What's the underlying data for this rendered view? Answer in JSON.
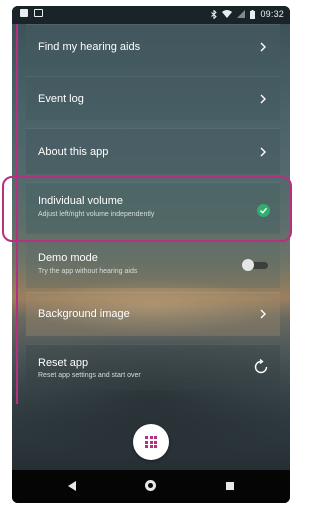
{
  "status_bar": {
    "time": "09:32",
    "icons": [
      "notification-icon",
      "photo-icon",
      "bluetooth-icon",
      "wifi-icon",
      "signal-icon",
      "battery-icon"
    ]
  },
  "menu": {
    "items": [
      {
        "label": "Find my hearing aids",
        "control": "chevron"
      },
      {
        "label": "Event log",
        "control": "chevron"
      },
      {
        "label": "About this app",
        "control": "chevron"
      },
      {
        "label": "Individual volume",
        "sublabel": "Adjust left/right volume independently",
        "control": "check",
        "checked": true
      },
      {
        "label": "Demo mode",
        "sublabel": "Try the app without hearing aids",
        "control": "toggle",
        "on": false
      },
      {
        "label": "Background image",
        "control": "chevron"
      },
      {
        "label": "Reset app",
        "sublabel": "Reset app settings and start over",
        "control": "reset"
      }
    ]
  },
  "fab": {
    "icon": "grid-icon"
  },
  "nav_bar": {
    "icons": [
      "back-icon",
      "home-icon",
      "recent-apps-icon"
    ]
  },
  "colors": {
    "accent": "#b5307f",
    "check": "#2fae6e"
  }
}
